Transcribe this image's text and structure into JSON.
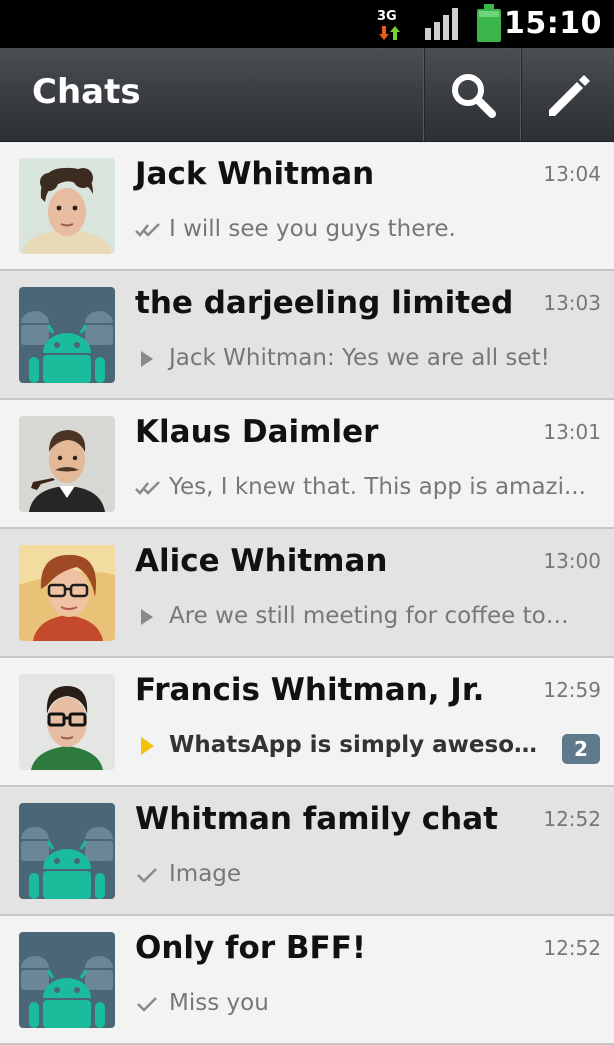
{
  "status_bar": {
    "time": "15:10",
    "network_label": "3G",
    "icons": [
      "network-3g-icon",
      "signal-icon",
      "battery-icon"
    ]
  },
  "action_bar": {
    "title": "Chats",
    "icons": [
      "search-icon",
      "compose-icon"
    ]
  },
  "colors": {
    "action_bar": "#3a3e42",
    "status_bar": "#000000",
    "row_light": "#f3f3f3",
    "row_dark": "#e3e3e3",
    "badge": "#5f7a8a",
    "battery": "#39b54a",
    "unread_arrow": "#f2c10c",
    "android_teal": "#1abc9c"
  },
  "chats": [
    {
      "name": "Jack Whitman",
      "time": "13:04",
      "preview": "I will see you guys there.",
      "status_icon": "double-check-icon",
      "avatar": "jack-photo-avatar"
    },
    {
      "name": "the darjeeling limited",
      "time": "13:03",
      "preview": "Jack Whitman: Yes we are all set!",
      "status_icon": "play-arrow-icon",
      "avatar": "android-group-avatar"
    },
    {
      "name": "Klaus Daimler",
      "time": "13:01",
      "preview": "Yes, I knew that. This app is amazi...",
      "status_icon": "double-check-icon",
      "avatar": "klaus-photo-avatar"
    },
    {
      "name": "Alice Whitman",
      "time": "13:00",
      "preview": "Are we still meeting for coffee tom...",
      "status_icon": "play-arrow-icon",
      "avatar": "alice-photo-avatar"
    },
    {
      "name": "Francis Whitman, Jr.",
      "time": "12:59",
      "preview": "WhatsApp is simply awesome.",
      "status_icon": "unread-arrow-icon",
      "unread_count": "2",
      "avatar": "francis-photo-avatar"
    },
    {
      "name": "Whitman family chat",
      "time": "12:52",
      "preview": "Image",
      "status_icon": "single-check-icon",
      "avatar": "android-group-avatar"
    },
    {
      "name": "Only for BFF!",
      "time": "12:52",
      "preview": "Miss you",
      "status_icon": "single-check-icon",
      "avatar": "android-group-avatar"
    }
  ]
}
